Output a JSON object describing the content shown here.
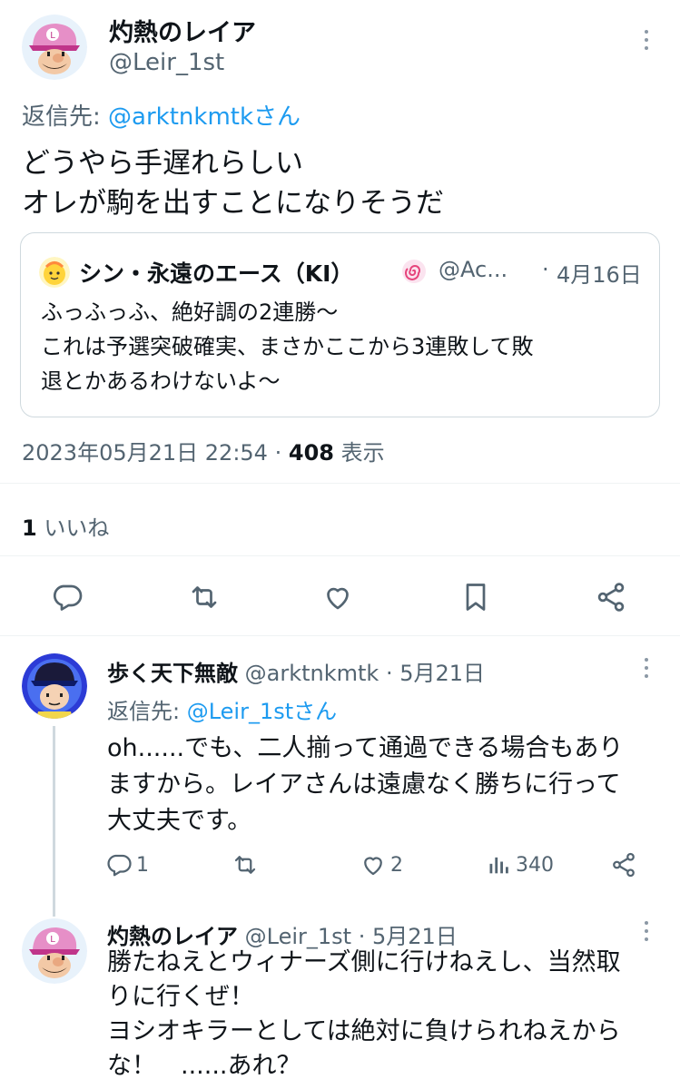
{
  "main_tweet": {
    "author_name": "灼熱のレイア",
    "author_handle": "@Leir_1st",
    "reply_prefix": "返信先: ",
    "reply_to": "@arktnkmtkさん",
    "text_line1": "どうやら手遅れらしい",
    "text_line2": "オレが駒を出すことになりそうだ",
    "quote": {
      "author_name": "シン・永遠のエース（KI）",
      "author_handle": "@Ac...",
      "separator": "·",
      "date": "4月16日",
      "text_line1": "ふっふっふ、絶好調の2連勝〜",
      "text_line2": "これは予選突破確実、まさかここから3連敗して敗",
      "text_line3": "退とかあるわけないよ〜"
    },
    "timestamp": "2023年05月21日 22:54",
    "separator": "·",
    "views_count": "408",
    "views_label": "表示",
    "likes_count": "1",
    "likes_label": "いいね"
  },
  "replies": [
    {
      "author_name": "歩く天下無敵",
      "author_handle": "@arktnkmtk",
      "separator": "·",
      "date": "5月21日",
      "reply_prefix": "返信先: ",
      "reply_to": "@Leir_1stさん",
      "text_line1": "oh......でも、二人揃って通過できる場合もあり",
      "text_line2": "ますから。レイアさんは遠慮なく勝ちに行って",
      "text_line3": "大丈夫です。",
      "reply_count": "1",
      "like_count": "2",
      "view_count": "340"
    },
    {
      "author_name": "灼熱のレイア",
      "author_handle": "@Leir_1st",
      "separator": "·",
      "date": "5月21日",
      "text_line1": "勝たねえとウィナーズ側に行けねえし、当然取",
      "text_line2": "りに行くぜ！",
      "text_line3": "ヨシオキラーとしては絶対に負けられねえから",
      "text_line4": "な！　......あれ？"
    }
  ],
  "colors": {
    "text": "#0f1419",
    "muted": "#536471",
    "link": "#1d9bf0",
    "divider": "#eff3f4"
  },
  "icons": [
    "more-icon",
    "reply-icon",
    "retweet-icon",
    "like-icon",
    "bookmark-icon",
    "share-icon",
    "views-icon",
    "verified-badge-icon"
  ]
}
